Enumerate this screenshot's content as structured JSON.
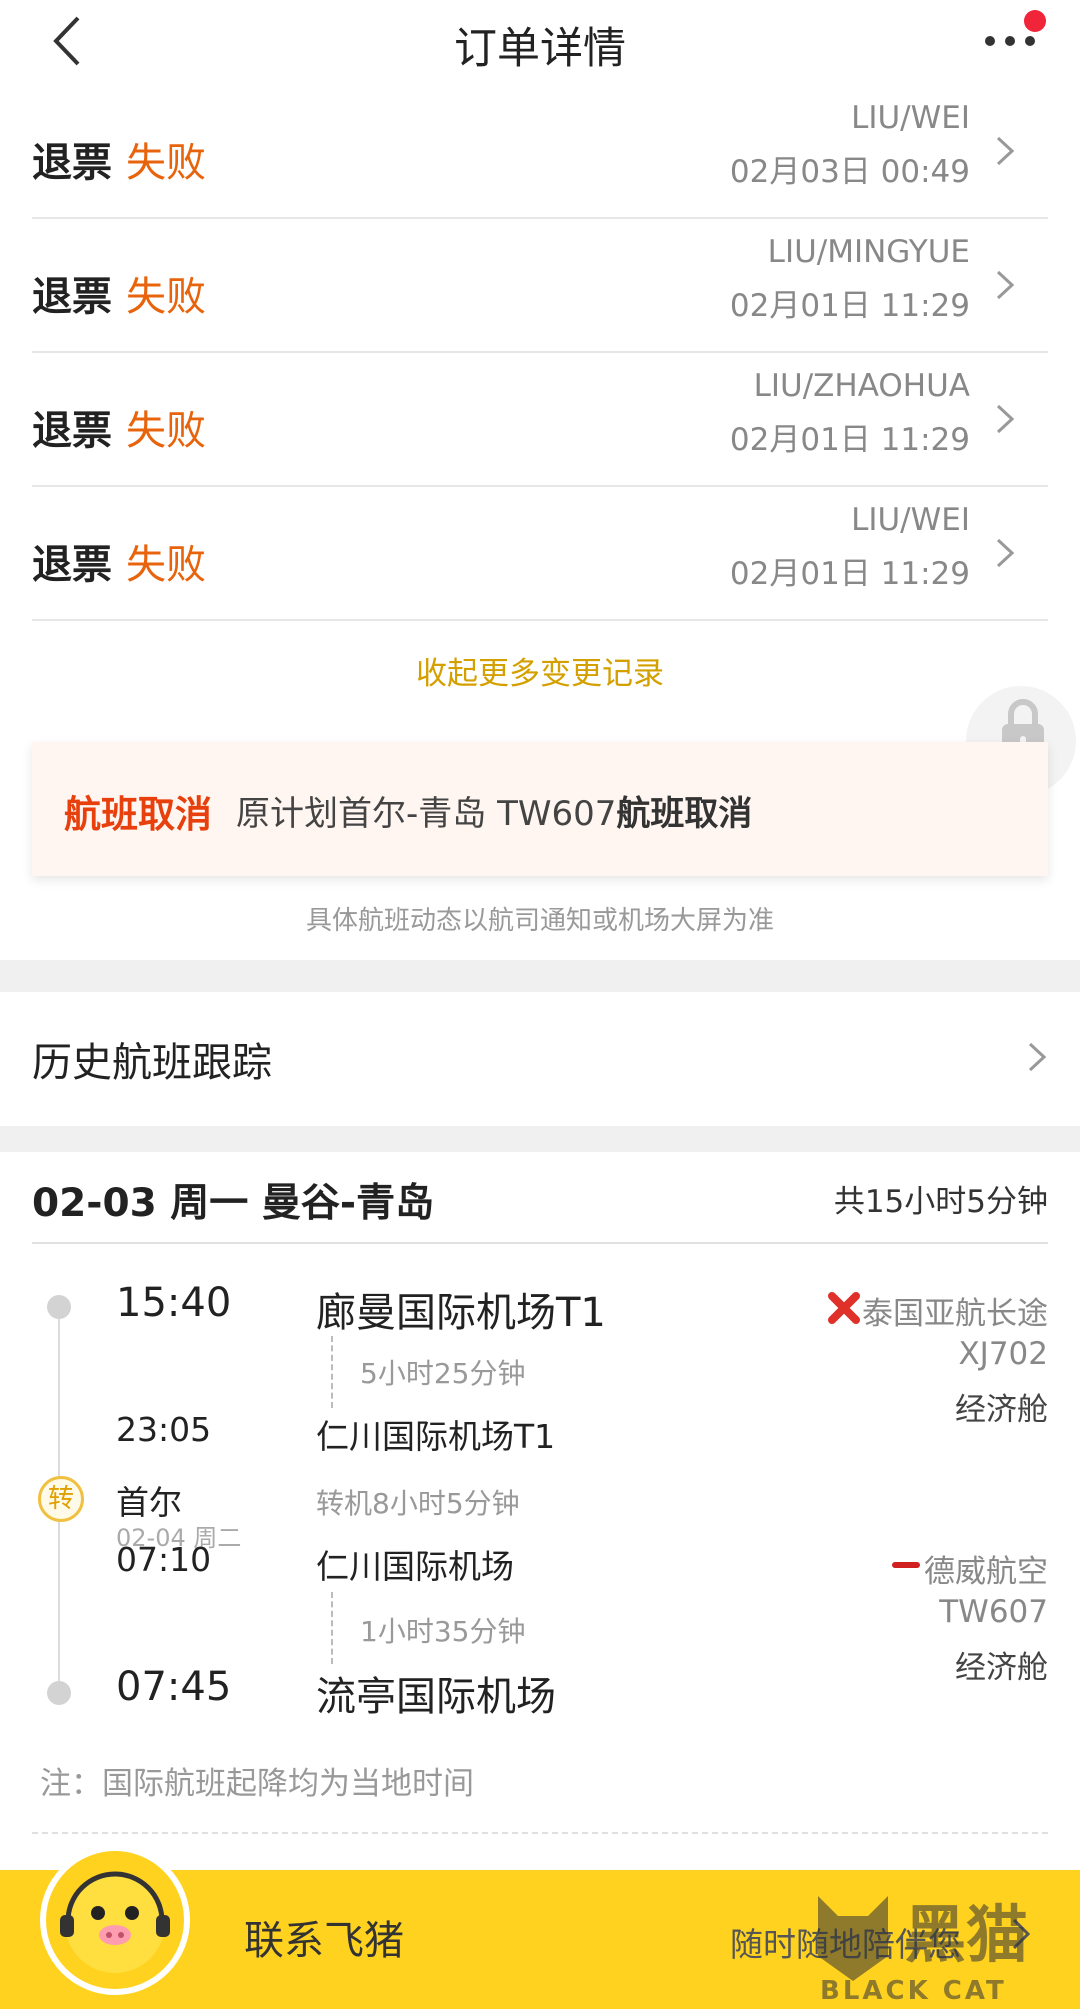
{
  "header": {
    "title": "订单详情"
  },
  "refund_records": [
    {
      "label": "退票",
      "status": "失败",
      "name": "LIU/WEI",
      "time": "02月03日 00:49"
    },
    {
      "label": "退票",
      "status": "失败",
      "name": "LIU/MINGYUE",
      "time": "02月01日 11:29"
    },
    {
      "label": "退票",
      "status": "失败",
      "name": "LIU/ZHAOHUA",
      "time": "02月01日 11:29"
    },
    {
      "label": "退票",
      "status": "失败",
      "name": "LIU/WEI",
      "time": "02月01日 11:29"
    }
  ],
  "collapse_link": "收起更多变更记录",
  "cancel_notice": {
    "tag": "航班取消",
    "text": "原计划首尔-青岛 TW607",
    "emphasis": "航班取消"
  },
  "notice_note": "具体航班动态以航司通知或机场大屏为准",
  "history_tracking": "历史航班跟踪",
  "trip": {
    "header": "02-03 周一 曼谷-青岛",
    "total_duration": "共15小时5分钟",
    "segments": [
      {
        "dep_time": "15:40",
        "dep_airport": "廊曼国际机场T1",
        "duration": "5小时25分钟",
        "arr_time": "23:05",
        "arr_airport": "仁川国际机场T1",
        "airline": "泰国亚航长途",
        "flight_no": "XJ702",
        "cabin": "经济舱"
      },
      {
        "dep_time": "07:10",
        "dep_airport": "仁川国际机场",
        "duration": "1小时35分钟",
        "arr_time": "07:45",
        "arr_airport": "流亭国际机场",
        "airline": "德威航空",
        "flight_no": "TW607",
        "cabin": "经济舱"
      }
    ],
    "transfer": {
      "icon_label": "转",
      "city": "首尔",
      "date": "02-04 周二",
      "duration": "转机8小时5分钟"
    },
    "remark": "注：国际航班起降均为当地时间"
  },
  "bottom_bar": {
    "contact": "联系飞猪",
    "slogan": "随时随地陪伴您"
  },
  "watermark": {
    "text": "黑猫",
    "subtext": "BLACK CAT"
  },
  "colors": {
    "status_fail": "#e8640c",
    "accent_yellow": "#ffd21f",
    "cancel_red": "#e8400c",
    "link_gold": "#d4a000"
  }
}
